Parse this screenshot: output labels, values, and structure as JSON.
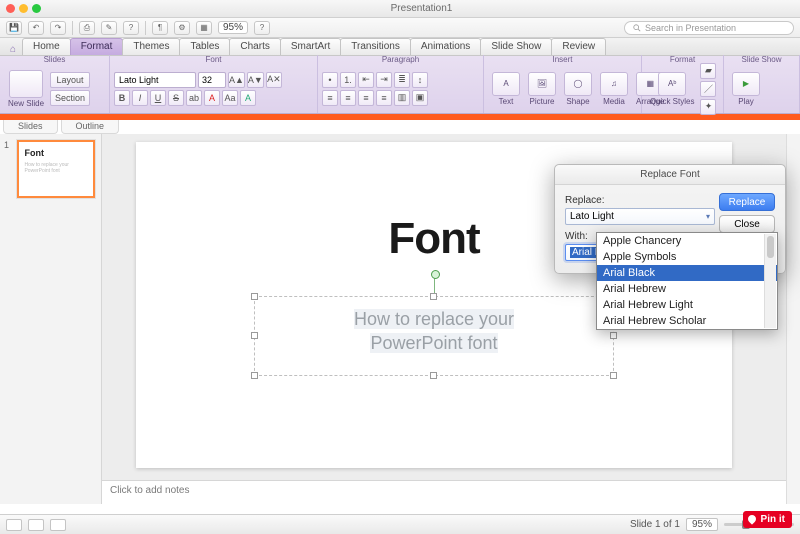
{
  "window": {
    "title": "Presentation1"
  },
  "qat": {
    "zoom": "95%",
    "search_placeholder": "Search in Presentation"
  },
  "tabs": {
    "items": [
      "Home",
      "Format",
      "Themes",
      "Tables",
      "Charts",
      "SmartArt",
      "Transitions",
      "Animations",
      "Slide Show",
      "Review"
    ],
    "active": "Format"
  },
  "ribbon": {
    "group_labels": [
      "Slides",
      "Font",
      "Paragraph",
      "Insert",
      "Format",
      "Slide Show"
    ],
    "slides": {
      "new_slide": "New Slide",
      "layout": "Layout",
      "section": "Section"
    },
    "font": {
      "name": "Lato Light",
      "size": "32",
      "buttons": {
        "bold": "B",
        "italic": "I",
        "underline": "U",
        "strike": "S",
        "grow": "A▲",
        "shrink": "A▼",
        "clear": "A✕",
        "color": "A",
        "highlight": "ab",
        "case": "Aa"
      }
    },
    "paragraph": {
      "buttons": {
        "bullets": "•",
        "numbers": "1.",
        "indent_dec": "⇤",
        "indent_inc": "⇥",
        "line_spacing": "≣",
        "align_l": "≡",
        "align_c": "≡",
        "align_r": "≡",
        "justify": "≡",
        "columns": "▥",
        "direction": "↕"
      }
    },
    "insert": {
      "text": "Text",
      "picture": "Picture",
      "shape": "Shape",
      "media": "Media",
      "arrange": "Arrange"
    },
    "format": {
      "quick_styles": "Quick Styles"
    },
    "slideshow": {
      "play": "Play"
    }
  },
  "subtabs": {
    "slides": "Slides",
    "outline": "Outline"
  },
  "thumbnail": {
    "number": "1",
    "title": "Font",
    "subtitle": "How to replace your PowerPoint font"
  },
  "slide": {
    "title": "Font",
    "subtitle_line1": "How to replace your",
    "subtitle_line2": "PowerPoint font"
  },
  "notes": {
    "placeholder": "Click to add notes"
  },
  "dialog": {
    "title": "Replace Font",
    "replace_label": "Replace:",
    "replace_value": "Lato Light",
    "with_label": "With:",
    "with_value": "Arial Black",
    "replace_btn": "Replace",
    "close_btn": "Close",
    "options": [
      "Apple Chancery",
      "Apple Symbols",
      "Arial Black",
      "Arial Hebrew",
      "Arial Hebrew Light",
      "Arial Hebrew Scholar"
    ],
    "selected_option": "Arial Black"
  },
  "status": {
    "slide_pos": "Slide 1 of 1",
    "zoom": "95%"
  },
  "pinit": {
    "label": "Pin it"
  }
}
